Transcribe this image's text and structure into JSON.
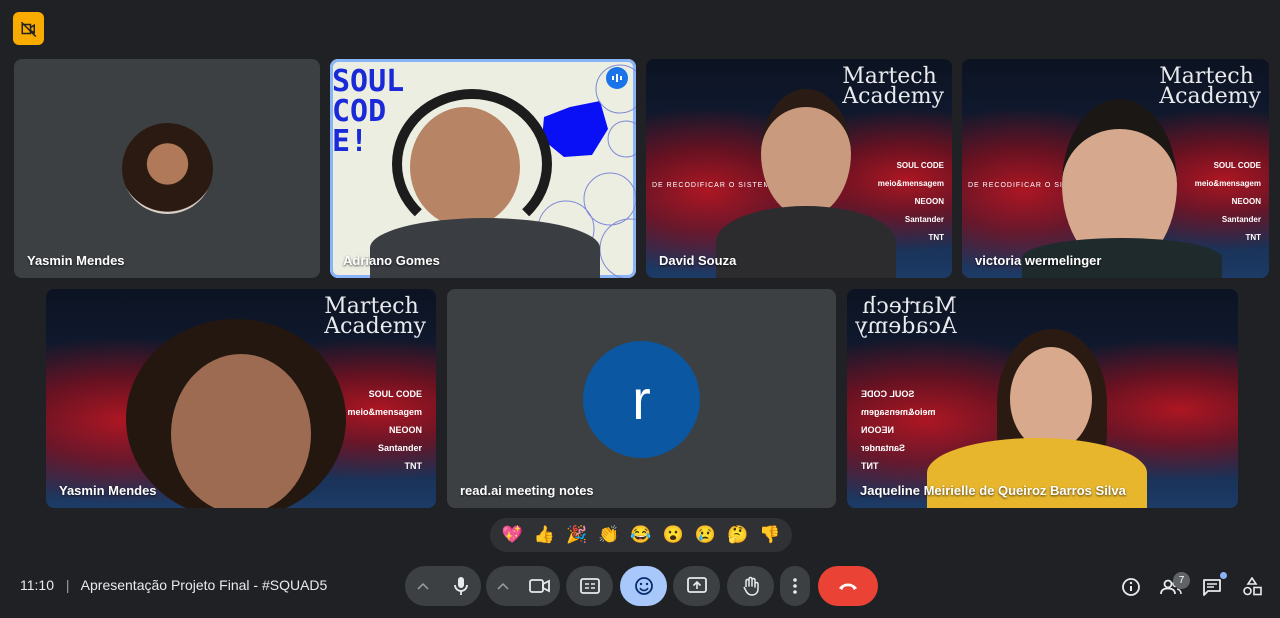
{
  "tiles": [
    {
      "name": "Yasmin Mendes"
    },
    {
      "name": "Adriano Gomes"
    },
    {
      "name": "David Souza"
    },
    {
      "name": "victoria wermelinger"
    },
    {
      "name": "Yasmin Mendes"
    },
    {
      "name": "read.ai meeting notes",
      "avatar_letter": "r"
    },
    {
      "name": "Jaqueline Meirielle de Queiroz Barros Silva"
    }
  ],
  "backgrounds": {
    "soulcode_text": "SOUL CODE!",
    "martech_line1": "Martech",
    "martech_line2": "Academy",
    "banner_text": "DE RECODIFICAR O SISTEMA",
    "logos": [
      "SOUL CODE",
      "meio&mensagem",
      "NEOON",
      "Santander",
      "TNT"
    ]
  },
  "reactions": [
    "💖",
    "👍",
    "🎉",
    "👏",
    "😂",
    "😮",
    "😢",
    "🤔",
    "👎"
  ],
  "meeting": {
    "time": "11:10",
    "separator": "|",
    "title": "Apresentação Projeto Final - #SQUAD5"
  },
  "participants_count": "7",
  "colors": {
    "accent": "#8ab4f8",
    "end_call": "#ea4335",
    "badge": "#f9ab00",
    "avatar_blue": "#0b57a1"
  }
}
